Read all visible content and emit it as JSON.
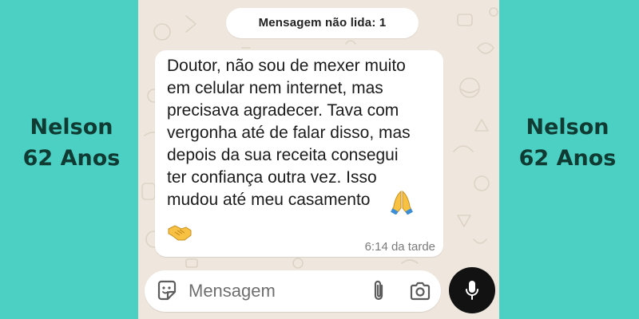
{
  "side_label": {
    "name": "Nelson",
    "age": "62 Anos"
  },
  "chat": {
    "unread_banner": "Mensagem não lida: 1",
    "message": {
      "text": "Doutor, não sou de mexer muito\nem celular nem internet, mas\nprecisava agradecer. Tava com\nvergonha até de falar disso, mas\ndepois da sua receita consegui\nter confiança outra vez. Isso\nmudou até meu casamento",
      "emojis": [
        "folded-hands-emoji",
        "handshake-emoji"
      ],
      "time": "6:14 da tarde"
    },
    "wallpaper_color": "#efe7dd"
  },
  "composer": {
    "placeholder": "Mensagem",
    "icons": [
      "sticker-icon",
      "attach-icon",
      "camera-icon",
      "mic-icon"
    ]
  },
  "colors": {
    "background": "#4dd0c4",
    "label_text": "#0f3b33",
    "mic_button": "#121212"
  }
}
